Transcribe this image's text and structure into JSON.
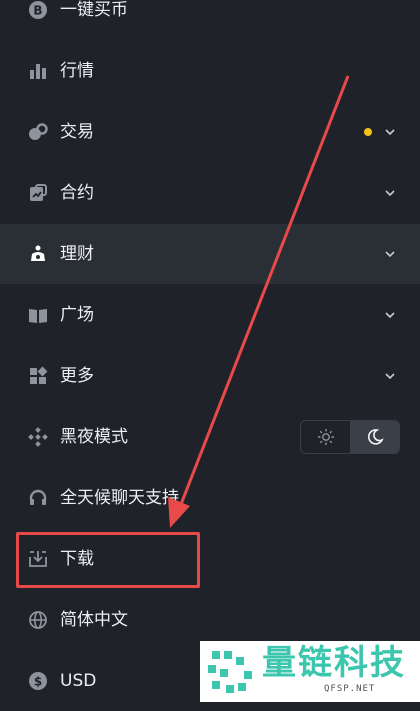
{
  "colors": {
    "bg": "#1f2228",
    "active_row": "#2a2e35",
    "accent_yellow": "#f0c419",
    "annotation_red": "#e84a4a",
    "watermark_green": "#3cc6ad"
  },
  "menu": {
    "items": [
      {
        "label": "一键买币",
        "icon": "bitcoin-icon"
      },
      {
        "label": "行情",
        "icon": "bar-chart-icon"
      },
      {
        "label": "交易",
        "icon": "trade-icon",
        "has_dot": true,
        "has_chevron": true
      },
      {
        "label": "合约",
        "icon": "contract-icon",
        "has_chevron": true
      },
      {
        "label": "理财",
        "icon": "piggy-bank-icon",
        "has_chevron": true,
        "active": true
      },
      {
        "label": "广场",
        "icon": "book-open-icon",
        "has_chevron": true
      },
      {
        "label": "更多",
        "icon": "grid-icon",
        "has_chevron": true
      },
      {
        "label": "黑夜模式",
        "icon": "binance-logo-icon",
        "theme_toggle": {
          "options": [
            "sun-icon",
            "moon-icon"
          ],
          "selected": "moon-icon"
        }
      },
      {
        "label": "全天候聊天支持",
        "icon": "headset-icon"
      },
      {
        "label": "下载",
        "icon": "download-icon",
        "highlighted": true
      },
      {
        "label": "简体中文",
        "icon": "globe-icon"
      },
      {
        "label": "USD",
        "icon": "dollar-icon"
      }
    ]
  },
  "watermark": {
    "title": "量链科技",
    "subtitle": "QFSP.NET"
  }
}
